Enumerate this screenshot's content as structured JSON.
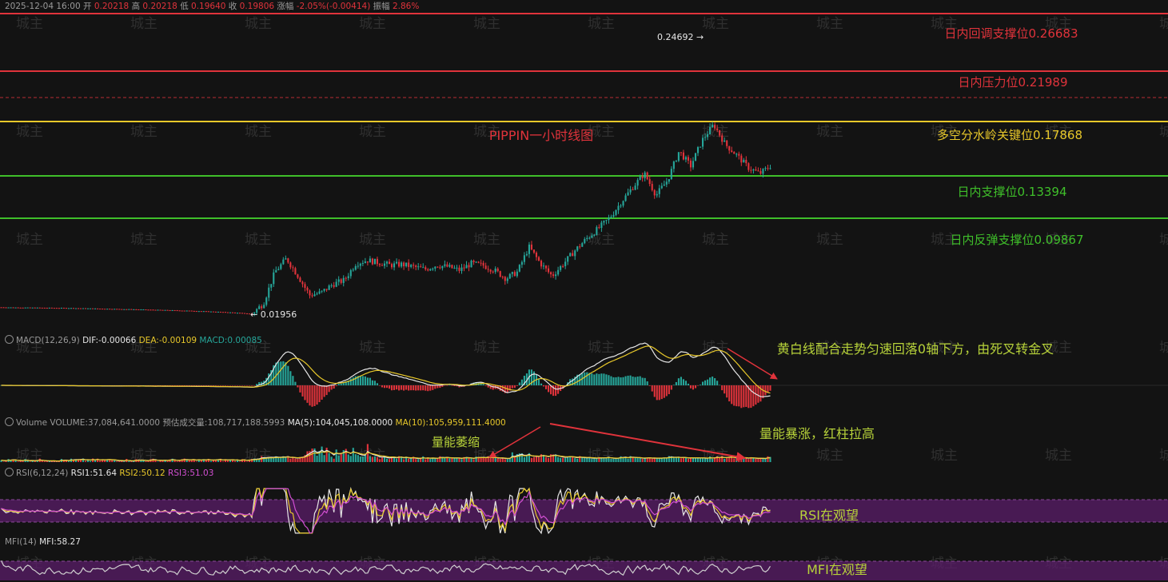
{
  "header": {
    "datetime": "2025-12-04 16:00",
    "open_label": "开",
    "open": "0.20218",
    "high_label": "高",
    "high": "0.20218",
    "low_label": "低",
    "low": "0.19640",
    "close_label": "收",
    "close": "0.19806",
    "change_label": "涨幅",
    "change": "-2.05%(-0.00414)",
    "amp_label": "振幅",
    "amp": "2.86%"
  },
  "watermark": "城主",
  "colors": {
    "up": "#26a69a",
    "down": "#e0333b",
    "white": "#e6e6e6",
    "yellow": "#e8c82a",
    "magenta": "#d24fd2",
    "green_line": "#3fbf2a",
    "purple_band": "#5b1e6a"
  },
  "price_panel": {
    "title": "PIPPIN一小时线图",
    "high_marker": "0.24692",
    "low_marker": "0.01956",
    "levels": [
      {
        "label": "日内回调支撑位0.26683",
        "value": 0.26683,
        "color": "#e0333b"
      },
      {
        "label": "日内压力位0.21989",
        "value": 0.21989,
        "color": "#e0333b"
      },
      {
        "label": "多空分水岭关键位0.17868",
        "value": 0.17868,
        "color": "#e8c82a"
      },
      {
        "label": "日内支撑位0.13394",
        "value": 0.13394,
        "color": "#3fbf2a"
      },
      {
        "label": "日内反弹支撑位0.09867",
        "value": 0.09867,
        "color": "#3fbf2a"
      }
    ],
    "current_price": 0.19806
  },
  "macd_panel": {
    "label": "MACD(12,26,9)",
    "dif": "DIF:-0.00066",
    "dea": "DEA:-0.00109",
    "macd": "MACD:0.00085",
    "annotation": "黄白线配合走势匀速回落0轴下方，由死叉转金叉"
  },
  "volume_panel": {
    "label": "Volume",
    "volume": "VOLUME:37,084,641.0000",
    "est": "预估成交量:108,717,188.5993",
    "ma5": "MA(5):104,045,108.0000",
    "ma10": "MA(10):105,959,111.4000",
    "annotation_shrink": "量能萎缩",
    "annotation_surge": "量能暴涨，红柱拉高"
  },
  "rsi_panel": {
    "label": "RSI(6,12,24)",
    "rsi1": "RSI1:51.64",
    "rsi2": "RSI2:50.12",
    "rsi3": "RSI3:51.03",
    "annotation": "RSI在观望"
  },
  "mfi_panel": {
    "label": "MFI(14)",
    "mfi": "MFI:58.27",
    "annotation": "MFI在观望"
  },
  "chart_data": {
    "type": "line",
    "title": "PIPPIN一小时线图",
    "ylabel": "",
    "xlabel": "",
    "series": [
      {
        "values": [
          0.0275,
          0.0272,
          0.027,
          0.0268,
          0.0266,
          0.0262,
          0.0258,
          0.0254,
          0.025,
          0.0245,
          0.024,
          0.0235,
          0.0228,
          0.022,
          0.021,
          0.0196,
          0.032,
          0.07,
          0.086,
          0.065,
          0.042,
          0.045,
          0.055,
          0.06,
          0.08,
          0.084,
          0.081,
          0.078,
          0.079,
          0.076,
          0.073,
          0.078,
          0.076,
          0.072,
          0.08,
          0.078,
          0.072,
          0.062,
          0.07,
          0.1,
          0.08,
          0.065,
          0.08,
          0.096,
          0.11,
          0.122,
          0.135,
          0.154,
          0.172,
          0.188,
          0.162,
          0.18,
          0.215,
          0.197,
          0.228,
          0.2469,
          0.223,
          0.21,
          0.195,
          0.188,
          0.198
        ]
      }
    ]
  }
}
